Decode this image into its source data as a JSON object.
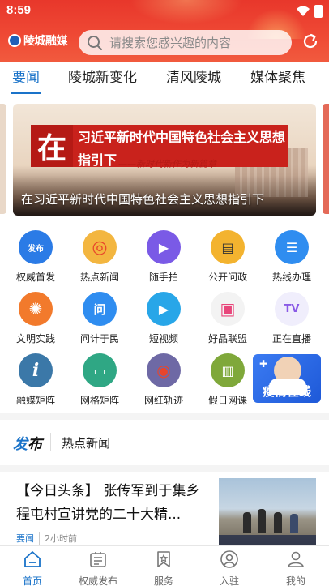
{
  "status": {
    "time": "8:59"
  },
  "header": {
    "logo_text": "陵城融媒",
    "search_placeholder": "请搜索您感兴趣的内容"
  },
  "tabs": [
    {
      "label": "要闻",
      "active": true
    },
    {
      "label": "陵城新变化",
      "active": false
    },
    {
      "label": "清风陵城",
      "active": false
    },
    {
      "label": "媒体聚焦",
      "active": false
    }
  ],
  "banner": {
    "big_char": "在",
    "line1": "习近平新时代中国特色社会主义思想",
    "line2": "指引下",
    "slogan": "——新时代新作为新篇章",
    "caption": "在习近平新时代中国特色社会主义思想指引下"
  },
  "grid": [
    {
      "label": "权威首发",
      "icon": "fabu-icon",
      "glyph": "发布",
      "color": "#2b7be6"
    },
    {
      "label": "热点新闻",
      "icon": "hot-news-icon",
      "glyph": "◎",
      "color": "#f0a23a"
    },
    {
      "label": "随手拍",
      "icon": "video-camera-icon",
      "glyph": "▶",
      "color": "#7a5ae6"
    },
    {
      "label": "公开问政",
      "icon": "document-icon",
      "glyph": "▤",
      "color": "#f3b32f"
    },
    {
      "label": "热线办理",
      "icon": "hotline-icon",
      "glyph": "☰",
      "color": "#2f8df0"
    },
    {
      "label": "文明实践",
      "icon": "palm-icon",
      "glyph": "✺",
      "color": "#f27a2c"
    },
    {
      "label": "问计于民",
      "icon": "question-icon",
      "glyph": "问",
      "color": "#2f8df0"
    },
    {
      "label": "短视频",
      "icon": "film-icon",
      "glyph": "▶",
      "color": "#28a6e8"
    },
    {
      "label": "好品联盟",
      "icon": "gift-icon",
      "glyph": "▣",
      "color": "#f0f0f0"
    },
    {
      "label": "正在直播",
      "icon": "tv-icon",
      "glyph": "TV",
      "color": "#f0eefc"
    },
    {
      "label": "融媒矩阵",
      "icon": "info-icon",
      "glyph": "i",
      "color": "#3b78a8"
    },
    {
      "label": "网格矩阵",
      "icon": "chat-icon",
      "glyph": "▭",
      "color": "#2fa784"
    },
    {
      "label": "网红轨迹",
      "icon": "location-icon",
      "glyph": "◉",
      "color": "#6e69a5"
    },
    {
      "label": "假日网课",
      "icon": "printer-icon",
      "glyph": "▥",
      "color": "#7fa83a"
    }
  ],
  "epidemic": {
    "label": "疫情在线"
  },
  "fabu_section": {
    "logo_a": "发",
    "logo_b": "布",
    "title": "热点新闻"
  },
  "news": {
    "title": "【今日头条】 张传军到于集乡程屯村宣讲党的二十大精...",
    "tag": "要闻",
    "time": "2小时前"
  },
  "bottom_nav": [
    {
      "label": "首页",
      "icon": "home-icon",
      "active": true
    },
    {
      "label": "权威发布",
      "icon": "list-icon",
      "active": false
    },
    {
      "label": "服务",
      "icon": "bookmark-icon",
      "active": false
    },
    {
      "label": "入驻",
      "icon": "face-icon",
      "active": false
    },
    {
      "label": "我的",
      "icon": "user-icon",
      "active": false
    }
  ],
  "colors": {
    "brand_red": "#e8372b",
    "accent_blue": "#1a73c9"
  }
}
